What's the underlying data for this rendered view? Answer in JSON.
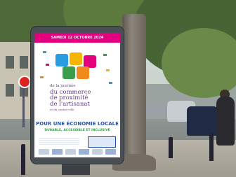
{
  "scene": {
    "type": "street-photo",
    "subject": "advertising-column",
    "colors": {
      "poster_accent": "#e3007e",
      "slogan_blue": "#2b53a6",
      "slogan_green": "#3a9e4a",
      "title_purple": "#6a3b8e"
    }
  },
  "poster": {
    "date_banner": "SAMEDI 12 OCTOBRE 2024",
    "title_lines": [
      "de la journée",
      "du commerce",
      "de proximité",
      "de l'artisanat",
      "et du centre-ville"
    ],
    "slogan": "POUR UNE ÉCONOMIE LOCALE",
    "tagline": "DURABLE, ACCESSIBLE ET INCLUSIVE"
  }
}
